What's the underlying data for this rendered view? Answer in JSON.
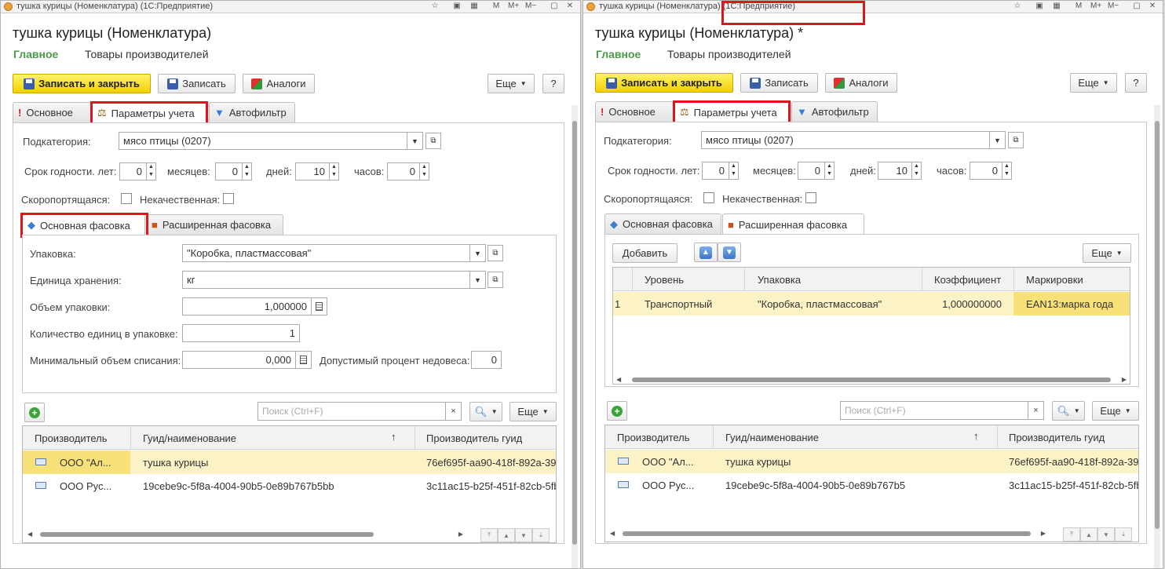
{
  "app_suffix": "(1С:Предприятие)",
  "left": {
    "window_title": "тушка курицы (Номенклатура)",
    "form_title": "тушка курицы (Номенклатура)"
  },
  "right": {
    "window_title": "тушка курицы (Номенклатура)",
    "form_title": "тушка курицы (Номенклатура) *"
  },
  "sections": {
    "main": "Главное",
    "producers": "Товары производителей"
  },
  "toolbar": {
    "save_close": "Записать и закрыть",
    "save": "Записать",
    "analogs": "Аналоги",
    "more": "Еще",
    "help": "?"
  },
  "tabs": {
    "basic": "Основное",
    "accounting": "Параметры учета",
    "autofilter": "Автофильтр"
  },
  "params": {
    "subcategory_label": "Подкатегория:",
    "subcategory_value": "мясо птицы (0207)",
    "shelf_label": "Срок годности. лет:",
    "years": "0",
    "months_label": "месяцев:",
    "months": "0",
    "days_label": "дней:",
    "days": "10",
    "hours_label": "часов:",
    "hours": "0",
    "perishable_label": "Скоропортящаяся:",
    "lowquality_label": "Некачественная:"
  },
  "packtabs": {
    "basic": "Основная фасовка",
    "extended": "Расширенная фасовка"
  },
  "basic_pack": {
    "package_label": "Упаковка:",
    "package_value": "\"Коробка, пластмассовая\"",
    "unit_label": "Единица хранения:",
    "unit_value": "кг",
    "volume_label": "Объем упаковки:",
    "volume_value": "1,000000",
    "qty_label": "Количество единиц в упаковке:",
    "qty_value": "1",
    "minvol_label": "Минимальный объем списания:",
    "minvol_value": "0,000",
    "underweight_label": "Допустимый процент недовеса:",
    "underweight_value": "0"
  },
  "extended_pack": {
    "add_button": "Добавить",
    "more": "Еще",
    "columns": [
      "Уровень",
      "Упаковка",
      "Коэффициент",
      "Маркировки"
    ],
    "rows": [
      {
        "n": "1",
        "level": "Транспортный",
        "package": "\"Коробка, пластмассовая\"",
        "coef": "1,000000000",
        "marks": "EAN13:марка года"
      }
    ]
  },
  "producers": {
    "search_placeholder": "Поиск (Ctrl+F)",
    "clear": "×",
    "more": "Еще",
    "columns": [
      "Производитель",
      "Гуид/наименование",
      "Производитель гуид"
    ],
    "sort_mark": "↑",
    "rows": [
      {
        "producer": "ООО \"Ал...",
        "guid": "тушка курицы",
        "pguid": "76ef695f-aa90-418f-892a-39c"
      },
      {
        "producer": "ООО Рус...",
        "guid": "19cebe9c-5f8a-4004-90b5-0e89b767b5bb",
        "pguid": "3c11ac15-b25f-451f-82cb-5fb"
      }
    ],
    "right_rows_guid2": "19cebe9c-5f8a-4004-90b5-0e89b767b5"
  },
  "colors": {
    "accent_green": "#4a9a4a",
    "highlight_red": "#e0151c",
    "selected_cell": "#f9e17a",
    "selected_row": "#fbf3c6",
    "primary_button": "#f2d000"
  }
}
